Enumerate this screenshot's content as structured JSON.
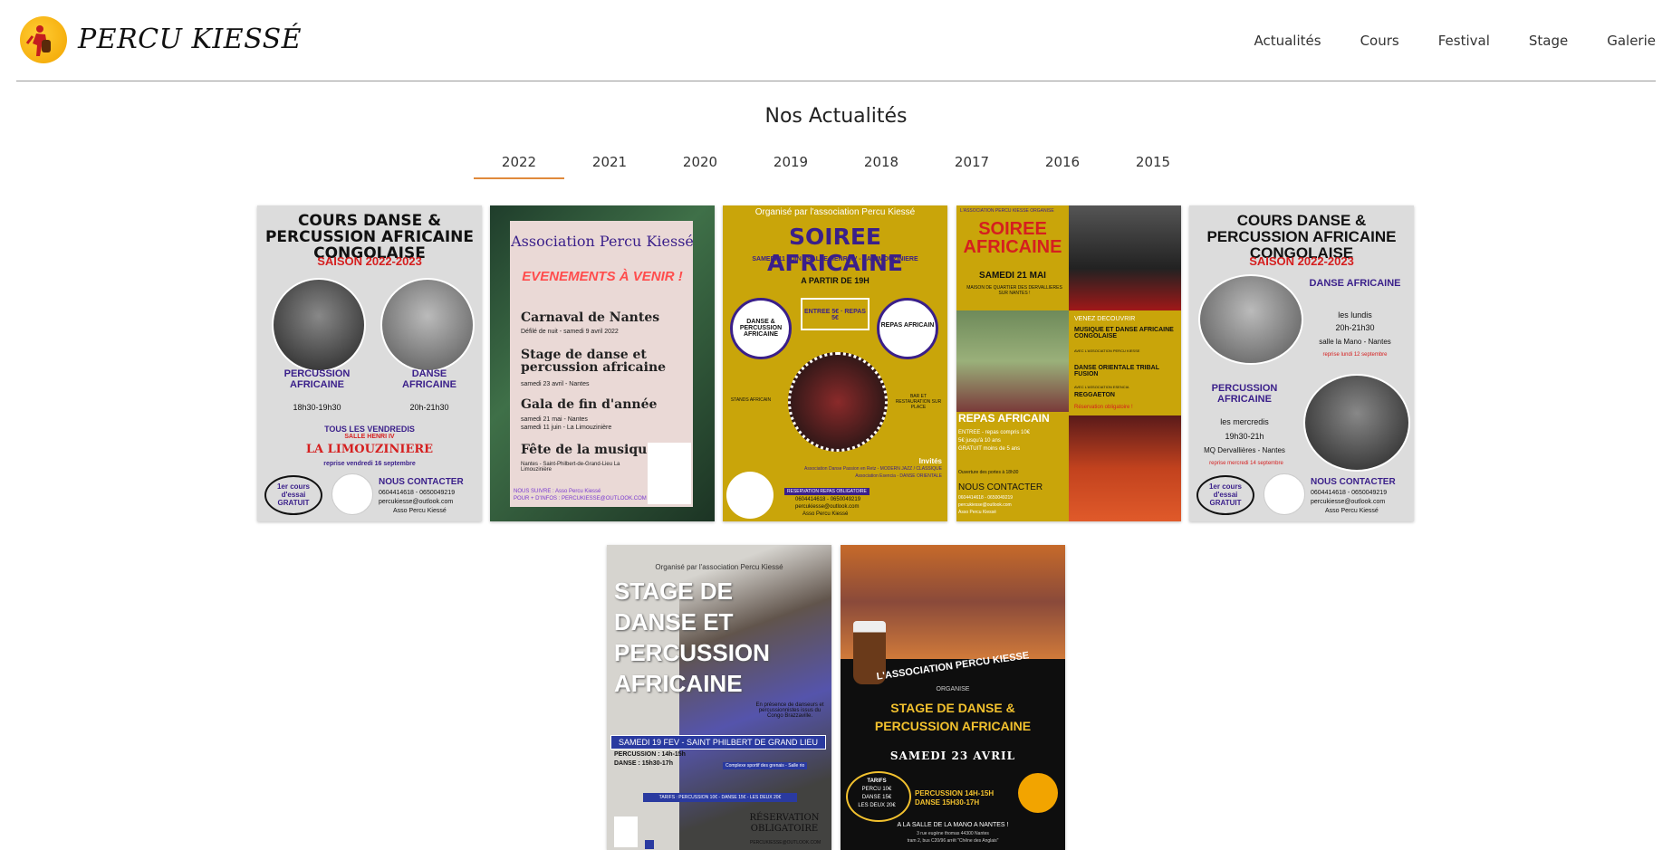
{
  "site": {
    "name": "PERCU KIESSÉ",
    "nav": [
      "Actualités",
      "Cours",
      "Festival",
      "Stage",
      "Galerie"
    ]
  },
  "page": {
    "title": "Nos Actualités",
    "years": [
      "2022",
      "2021",
      "2020",
      "2019",
      "2018",
      "2017",
      "2016",
      "2015"
    ],
    "active_year": "2022"
  },
  "posters": {
    "p1": {
      "title": "COURS DANSE & PERCUSSION AFRICAINE CONGOLAISE",
      "season": "SAISON 2022-2023",
      "left_label": "PERCUSSION AFRICAINE",
      "left_time": "18h30-19h30",
      "right_label": "DANSE AFRICAINE",
      "right_time": "20h-21h30",
      "days": "TOUS LES VENDREDIS",
      "venue_small": "SALLE HENRI IV",
      "venue": "LA LIMOUZINIERE",
      "resume": "reprise vendredi 16 septembre",
      "trial": "1er cours d'essai GRATUIT",
      "contact_title": "NOUS CONTACTER",
      "phones": "0604414618 - 0650049219",
      "email": "percukiesse@outlook.com",
      "fb": "Asso Percu Kiessé"
    },
    "p2": {
      "title": "Association Percu Kiessé",
      "banner": "EVENEMENTS À VENIR !",
      "e1": "Carnaval de Nantes",
      "e1_sub": "Défilé de nuit - samedi 9 avril 2022",
      "e2": "Stage de danse et percussion africaine",
      "e2_sub": "samedi 23 avril - Nantes",
      "e3": "Gala de fin d'année",
      "e3_sub1": "samedi 21 mai - Nantes",
      "e3_sub2": "samedi 11 juin - La Limouzinière",
      "e4": "Fête de la musique",
      "e4_sub": "Nantes - Saint-Philbert-de-Grand-Lieu La Limouzinière",
      "footer1": "NOUS SUIVRE : Asso Percu Kiessé",
      "footer2": "POUR + D'INFOS : PERCUKIESSE@OUTLOOK.COM"
    },
    "p3": {
      "top": "Organisé par l'association Percu Kiessé",
      "title": "SOIREE AFRICAINE",
      "sub": "SAMEDI 11 JUIN - SALLE HENRI IV - LA LIMOUZINIERE",
      "start": "A PARTIR DE 19H",
      "left": "DANSE & PERCUSSION AFRICAINE",
      "center": "ENTREE 5€ · REPAS 5€",
      "right": "REPAS AFRICAIN",
      "stands": "STANDS AFRICAIN",
      "bar": "BAR ET RESTAURATION SUR PLACE",
      "invites": "Invités",
      "g1": "Association Danse Passion en Retz - MODERN JAZZ / CLASSIQUE",
      "g2": "Association Esencia - DANSE ORIENTALE",
      "reserve": "RESERVATION REPAS OBLIGATOIRE",
      "phones": "0604414618 - 0650049219",
      "email": "percukiesse@outlook.com",
      "fb": "Asso Percu Kiessé"
    },
    "p4": {
      "top": "L'ASSOCIATION PERCU KIESSE ORGANISE",
      "title": "SOIREE AFRICAINE",
      "date": "SAMEDI 21 MAI",
      "place": "MAISON DE QUARTIER DES DERVALLIERES SUR NANTES !",
      "discover": "VENEZ DECOUVRIR",
      "d1": "MUSIQUE ET DANSE AFRICAINE CONGOLAISE",
      "d1_sub": "AVEC L'ASSOCIATION PERCU KIESSE",
      "d2": "DANSE ORIENTALE TRIBAL FUSION",
      "d2_sub": "AVEC L'ASSOCIATION ESENCIA",
      "d3": "REGGAETON",
      "mandatory": "Réservation obligatoire !",
      "meal": "REPAS AFRICAIN",
      "price1": "ENTREE - repas compris 10€",
      "price2": "5€ jusqu'à 10 ans",
      "price3": "GRATUIT moins de 5 ans",
      "doors": "Ouverture des portes à 18h30",
      "contact": "NOUS CONTACTER",
      "phones": "0604414618 - 0650049219",
      "email": "percukiesse@outlook.com",
      "fb": "Asso Percu Kiessé"
    },
    "p5": {
      "title": "COURS DANSE & PERCUSSION AFRICAINE CONGOLAISE",
      "season": "SAISON 2022-2023",
      "r_label": "DANSE AFRICAINE",
      "r_days": "les lundis",
      "r_time": "20h-21h30",
      "r_venue": "salle la Mano - Nantes",
      "r_resume": "reprise lundi 12 septembre",
      "l_label": "PERCUSSION AFRICAINE",
      "l_days": "les mercredis",
      "l_time": "19h30-21h",
      "l_venue": "MQ Dervallières - Nantes",
      "l_resume": "reprise mercredi 14 septembre",
      "trial": "1er cours d'essai GRATUIT",
      "contact_title": "NOUS CONTACTER",
      "phones": "0604414618 - 0650049219",
      "email": "percukiesse@outlook.com",
      "fb": "Asso Percu Kiessé"
    },
    "p6": {
      "top": "Organisé par l'association Percu Kiessé",
      "title": "STAGE DE DANSE ET PERCUSSION AFRICAINE",
      "presence": "En présence de danseurs et percussionnistes issus du Congo Brazzaville.",
      "date": "SAMEDI 19 FEV - SAINT PHILBERT DE GRAND LIEU",
      "perc": "PERCUSSION : 14h-15h",
      "dance": "DANSE : 15h30-17h",
      "venue": "Complexe sportif des grenais - Salle rio",
      "tarifs": "TARIFS : PERCUSSION 10€ - DANSE 15€ - LES DEUX 20€",
      "reserve": "RÉSERVATION OBLIGATOIRE",
      "email": "PERCUKIESSE@OUTLOOK.COM"
    },
    "p7": {
      "arc": "L'ASSOCIATION PERCU KIESSE",
      "org": "ORGANISE",
      "title": "STAGE DE DANSE & PERCUSSION AFRICAINE",
      "date": "SAMEDI 23 AVRIL",
      "tarifs": "TARIFS",
      "t1": "PERCU 10€",
      "t2": "DANSE 15€",
      "t3": "LES DEUX 20€",
      "times1": "PERCUSSION 14H-15H",
      "times2": "DANSE 15H30-17H",
      "where": "A LA SALLE DE LA MANO A NANTES !",
      "addr": "3 rue eugène thomas 44300 Nantes",
      "bus": "tram 2, bus C20/96 arrêt \"Chêne des Anglais\""
    }
  },
  "colors": {
    "accent": "#e08a3c",
    "purple": "#3a1f8a",
    "red": "#d51f1f",
    "gold": "#c9a50a",
    "grey_bg": "#dcdcdc"
  }
}
